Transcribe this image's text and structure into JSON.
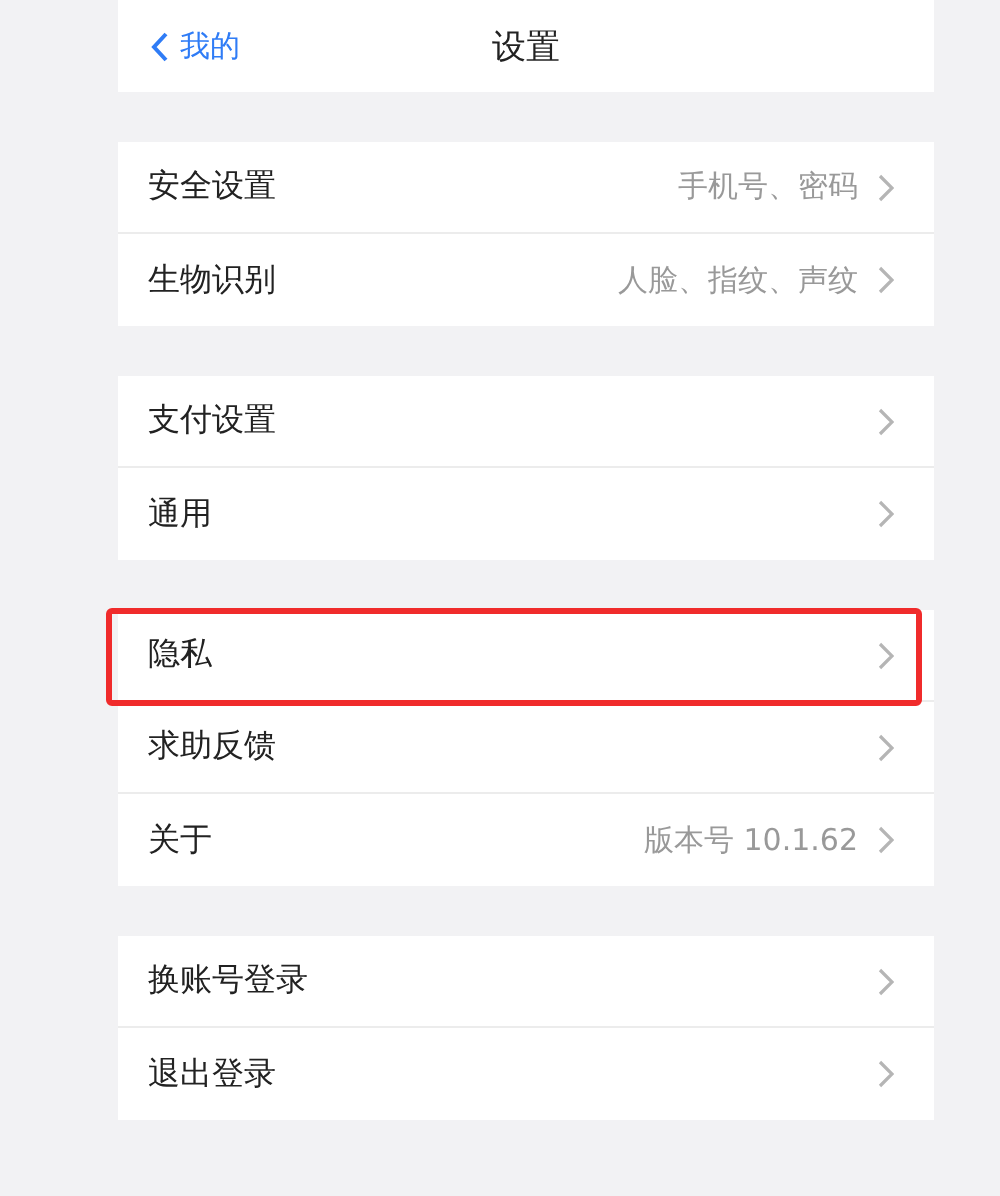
{
  "header": {
    "back_label": "我的",
    "title": "设置"
  },
  "groups": [
    {
      "rows": [
        {
          "label": "安全设置",
          "value": "手机号、密码",
          "highlighted": false
        },
        {
          "label": "生物识别",
          "value": "人脸、指纹、声纹",
          "highlighted": false
        }
      ]
    },
    {
      "rows": [
        {
          "label": "支付设置",
          "highlighted": false
        },
        {
          "label": "通用",
          "highlighted": false
        }
      ]
    },
    {
      "rows": [
        {
          "label": "隐私",
          "highlighted": true
        },
        {
          "label": "求助反馈",
          "highlighted": false
        },
        {
          "label": "关于",
          "value": "版本号 10.1.62",
          "highlighted": false
        }
      ]
    },
    {
      "rows": [
        {
          "label": "换账号登录",
          "highlighted": false
        },
        {
          "label": "退出登录",
          "highlighted": false
        }
      ]
    }
  ]
}
